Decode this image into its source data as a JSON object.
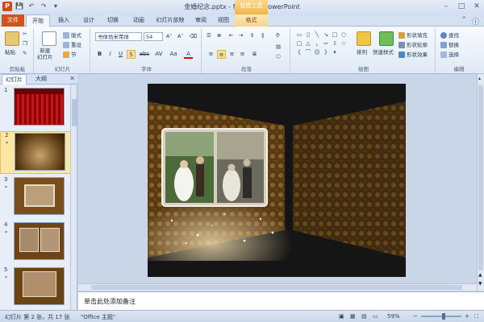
{
  "window": {
    "title": "金婚纪念.pptx - Microsoft PowerPoint",
    "context_tool_label": "绘图工具"
  },
  "qat": {
    "app_icon": "P",
    "icons": [
      "save-icon",
      "undo-icon",
      "redo-icon",
      "customize-qat-icon"
    ]
  },
  "tabs": {
    "file": "文件",
    "home": "开始",
    "insert": "插入",
    "design": "设计",
    "transitions": "切换",
    "animations": "动画",
    "slideshow": "幻灯片放映",
    "review": "审阅",
    "view": "视图",
    "format": "格式"
  },
  "ribbon": {
    "clipboard": {
      "paste": "粘贴",
      "label": "剪贴板"
    },
    "slides": {
      "new_slide": "新建\n幻灯片",
      "layout": "版式",
      "reset": "重设",
      "section": "节",
      "label": "幻灯片"
    },
    "font": {
      "name": "书体坊米芾体",
      "size": "54",
      "label": "字体",
      "bold": "B",
      "italic": "I",
      "underline": "U",
      "shadow": "S",
      "strike": "abc",
      "spacing": "AV",
      "case": "Aa",
      "color": "A"
    },
    "paragraph": {
      "label": "段落"
    },
    "drawing": {
      "arrange": "排列",
      "quick_styles": "快速样式",
      "shape_fill": "形状填充",
      "shape_outline": "形状轮廓",
      "shape_effects": "形状效果",
      "label": "绘图"
    },
    "editing": {
      "find": "查找",
      "replace": "替换",
      "select": "选择",
      "label": "编辑"
    }
  },
  "left_panel": {
    "tab_slides": "幻灯片",
    "tab_outline": "大纲",
    "close": "✕",
    "thumbnails": [
      {
        "num": "1",
        "star": "*"
      },
      {
        "num": "2",
        "star": "*"
      },
      {
        "num": "3",
        "star": "*"
      },
      {
        "num": "4",
        "star": "*"
      },
      {
        "num": "5",
        "star": "*"
      }
    ]
  },
  "notes": {
    "placeholder": "单击此处添加备注"
  },
  "status": {
    "slide_info": "幻灯片 第 2 张，共 17 张",
    "theme": "\"Office 主题\"",
    "zoom": "59%"
  },
  "colors": {
    "file_tab": "#d1531c",
    "context_tab": "#f2b54a",
    "ribbon_bg": "#dfe9f5",
    "selected_thumb": "#fbe6a3"
  }
}
